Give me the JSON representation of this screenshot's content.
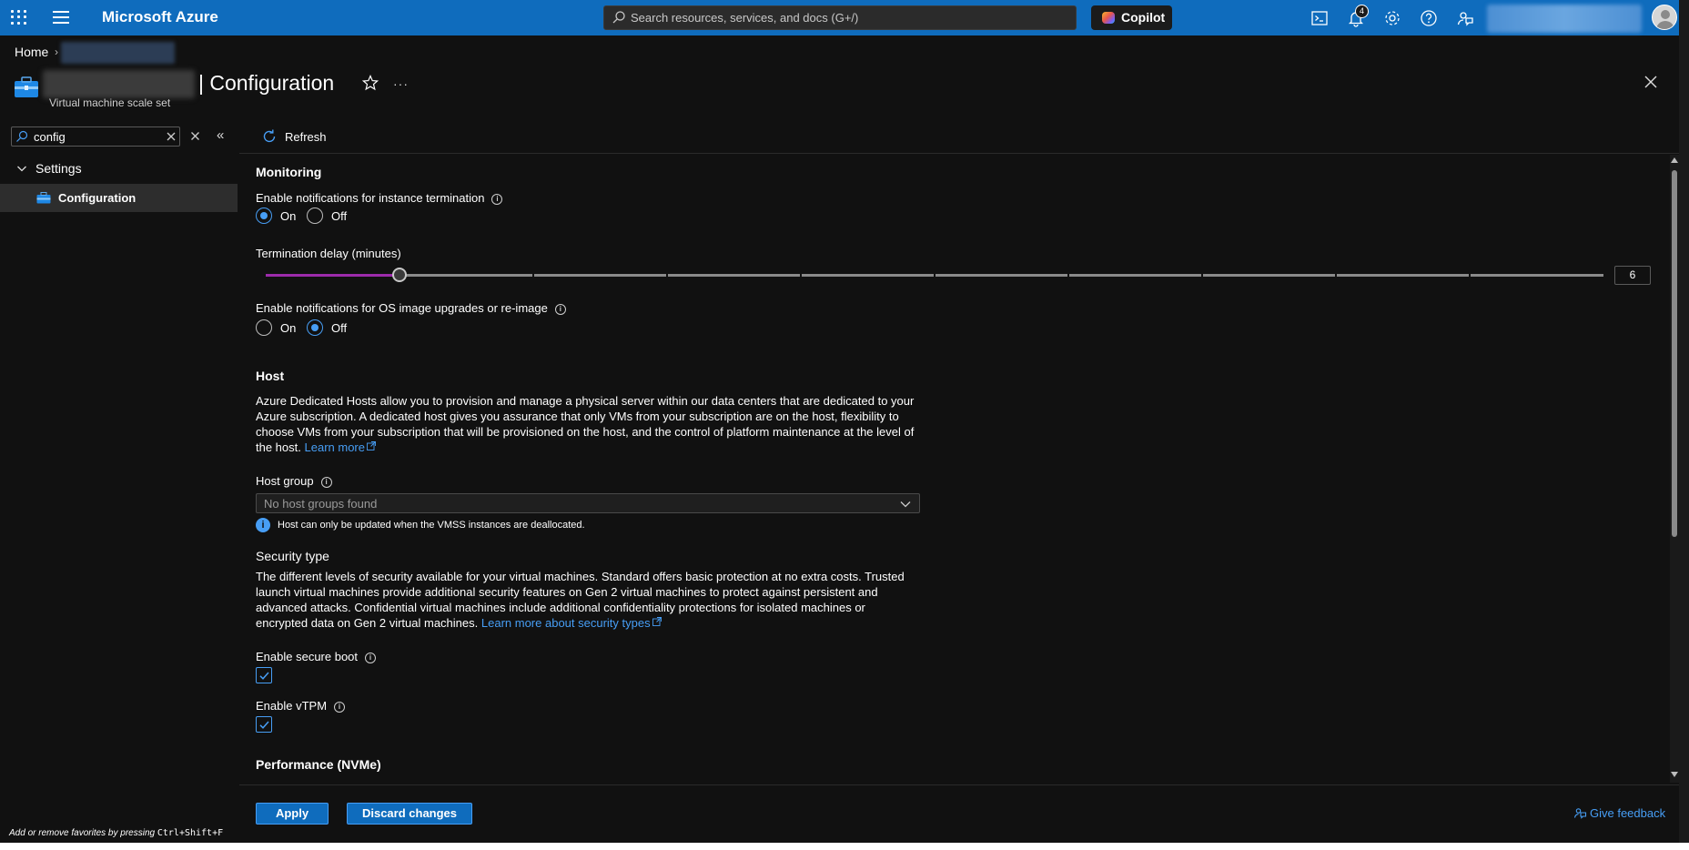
{
  "topbar": {
    "brand": "Microsoft Azure",
    "search_placeholder": "Search resources, services, and docs (G+/)",
    "copilot_label": "Copilot",
    "notification_count": "4",
    "icons": [
      "waffle-icon",
      "hamburger-icon",
      "search-icon",
      "cloud-shell-icon",
      "bell-icon",
      "gear-icon",
      "help-icon",
      "feedback-icon"
    ]
  },
  "breadcrumb": {
    "home": "Home",
    "separator": "›"
  },
  "header": {
    "title": "| Configuration",
    "subtitle": "Virtual machine scale set",
    "more": "···"
  },
  "nav": {
    "search_value": "config",
    "collapse_glyph": "«",
    "group_label": "Settings",
    "item_label": "Configuration",
    "favorites_hint_prefix": "Add or remove favorites by pressing ",
    "favorites_hint_keys": "Ctrl+Shift+F"
  },
  "toolbar": {
    "refresh_label": "Refresh"
  },
  "monitoring": {
    "heading": "Monitoring",
    "termination_label": "Enable notifications for instance termination",
    "termination_value": "On",
    "on_label": "On",
    "off_label": "Off",
    "delay_label": "Termination delay (minutes)",
    "delay_min": 0,
    "delay_max": 60,
    "delay_steps": 10,
    "delay_value": "6",
    "os_label": "Enable notifications for OS image upgrades or re-image",
    "os_value": "Off"
  },
  "host": {
    "heading": "Host",
    "description": "Azure Dedicated Hosts allow you to provision and manage a physical server within our data centers that are dedicated to your Azure subscription. A dedicated host gives you assurance that only VMs from your subscription are on the host, flexibility to choose VMs from your subscription that will be provisioned on the host, and the control of platform maintenance at the level of the host.",
    "learn_more": "Learn more",
    "group_label": "Host group",
    "group_value": "No host groups found",
    "note": "Host can only be updated when the VMSS instances are deallocated."
  },
  "security": {
    "heading": "Security type",
    "description": "The different levels of security available for your virtual machines. Standard offers basic protection at no extra costs. Trusted launch virtual machines provide additional security features on Gen 2 virtual machines to protect against persistent and advanced attacks. Confidential virtual machines include additional confidentiality protections for isolated machines or encrypted data on Gen 2 virtual machines.",
    "learn_more": "Learn more about security types",
    "secure_boot_label": "Enable secure boot",
    "secure_boot_checked": true,
    "vtpm_label": "Enable vTPM",
    "vtpm_checked": true
  },
  "performance": {
    "heading": "Performance (NVMe)"
  },
  "footer": {
    "apply_label": "Apply",
    "discard_label": "Discard changes",
    "feedback_label": "Give feedback"
  },
  "colors": {
    "azure_blue": "#0f6cbd",
    "link": "#479ef5",
    "slider_fill": "#9c2bab",
    "background": "#111111"
  }
}
